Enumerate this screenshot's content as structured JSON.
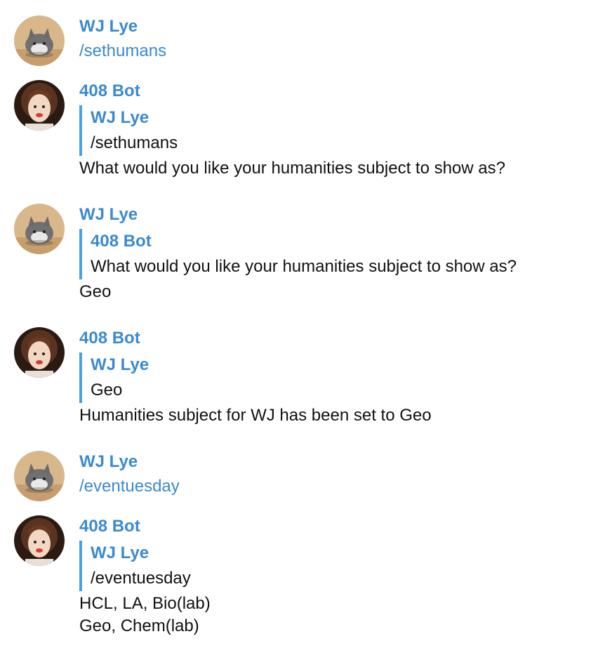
{
  "messages": [
    {
      "sender": "WJ Lye",
      "command": "/sethumans"
    },
    {
      "sender": "408 Bot",
      "reply_to": {
        "sender": "WJ Lye",
        "text": "/sethumans"
      },
      "text": "What would you like your humanities subject to show as?"
    },
    {
      "sender": "WJ Lye",
      "reply_to": {
        "sender": "408 Bot",
        "text": "What would you like your humanities subject to show as?"
      },
      "text": "Geo"
    },
    {
      "sender": "408 Bot",
      "reply_to": {
        "sender": "WJ Lye",
        "text": "Geo"
      },
      "text": "Humanities subject for WJ has been set to Geo"
    },
    {
      "sender": "WJ Lye",
      "command": "/eventuesday"
    },
    {
      "sender": "408 Bot",
      "reply_to": {
        "sender": "WJ Lye",
        "text": "/eventuesday"
      },
      "text_lines": [
        "HCL, LA, Bio(lab)",
        "Geo, Chem(lab)"
      ]
    }
  ],
  "colors": {
    "sender": "#3a8ad0",
    "reply_bar": "#4aa1e0",
    "text": "#111111",
    "background": "#ffffff"
  },
  "icons": {
    "user_avatar": "cat-avatar-icon",
    "bot_avatar": "doll-avatar-icon"
  }
}
